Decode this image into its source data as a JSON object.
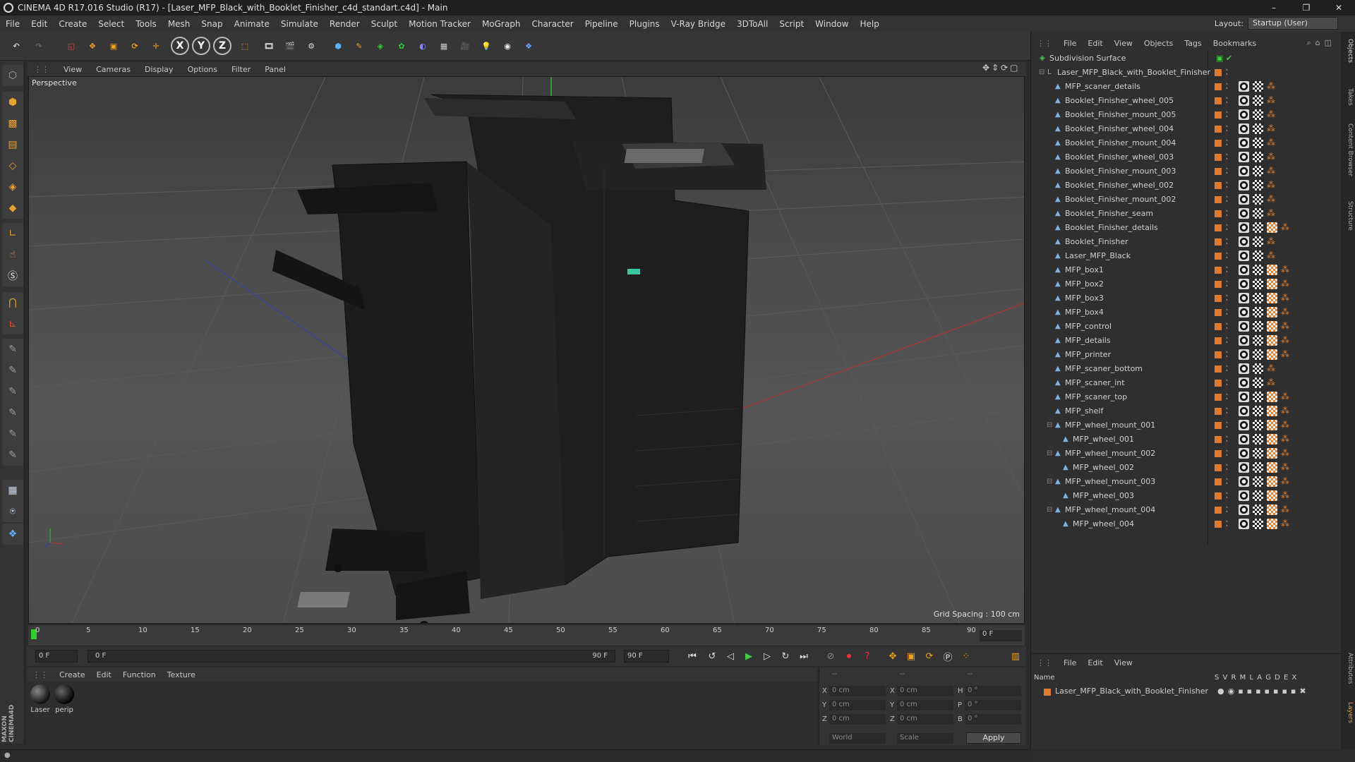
{
  "titlebar": {
    "title": "CINEMA 4D R17.016 Studio (R17) - [Laser_MFP_Black_with_Booklet_Finisher_c4d_standart.c4d] - Main",
    "minimize": "–",
    "maximize": "❐",
    "close": "✕"
  },
  "menu": [
    "File",
    "Edit",
    "Create",
    "Select",
    "Tools",
    "Mesh",
    "Snap",
    "Animate",
    "Simulate",
    "Render",
    "Sculpt",
    "Motion Tracker",
    "MoGraph",
    "Character",
    "Pipeline",
    "Plugins",
    "V-Ray Bridge",
    "3DToAll",
    "Script",
    "Window",
    "Help"
  ],
  "layout": {
    "label": "Layout:",
    "value": "Startup (User)"
  },
  "toolbar": {
    "axis_x": "X",
    "axis_y": "Y",
    "axis_z": "Z"
  },
  "viewport": {
    "menu": [
      "View",
      "Cameras",
      "Display",
      "Options",
      "Filter",
      "Panel"
    ],
    "label": "Perspective",
    "grid_spacing": "Grid Spacing : 100 cm"
  },
  "timeline": {
    "ticks": [
      "0",
      "5",
      "10",
      "15",
      "20",
      "25",
      "30",
      "35",
      "40",
      "45",
      "50",
      "55",
      "60",
      "65",
      "70",
      "75",
      "80",
      "85",
      "90"
    ],
    "end_field": "0 F"
  },
  "transport": {
    "start": "0 F",
    "range_start": "0 F",
    "range_end": "90 F",
    "end": "90 F"
  },
  "materials": {
    "menu": [
      "Create",
      "Edit",
      "Function",
      "Texture"
    ],
    "items": [
      {
        "label": "Laser"
      },
      {
        "label": "perip"
      }
    ]
  },
  "coords": {
    "header_left": "--",
    "header_mid": "--",
    "header_right": "--",
    "rows": [
      {
        "a": "X",
        "av": "0 cm",
        "b": "X",
        "bv": "0 cm",
        "c": "H",
        "cv": "0 °"
      },
      {
        "a": "Y",
        "av": "0 cm",
        "b": "Y",
        "bv": "0 cm",
        "c": "P",
        "cv": "0 °"
      },
      {
        "a": "Z",
        "av": "0 cm",
        "b": "Z",
        "bv": "0 cm",
        "c": "B",
        "cv": "0 °"
      }
    ],
    "mode1": "World",
    "mode2": "Scale",
    "apply": "Apply"
  },
  "object_manager": {
    "menu": [
      "File",
      "Edit",
      "View",
      "Objects",
      "Tags",
      "Bookmarks"
    ],
    "objects": [
      {
        "name": "Subdivision Surface",
        "indent": 0,
        "tags": "none"
      },
      {
        "name": "Laser_MFP_Black_with_Booklet_Finisher",
        "indent": 1,
        "tags": "none"
      },
      {
        "name": "MFP_scaner_details",
        "indent": 2,
        "tags": "abd"
      },
      {
        "name": "Booklet_Finisher_wheel_005",
        "indent": 2,
        "tags": "abd"
      },
      {
        "name": "Booklet_Finisher_mount_005",
        "indent": 2,
        "tags": "abd"
      },
      {
        "name": "Booklet_Finisher_wheel_004",
        "indent": 2,
        "tags": "abd"
      },
      {
        "name": "Booklet_Finisher_mount_004",
        "indent": 2,
        "tags": "abd"
      },
      {
        "name": "Booklet_Finisher_wheel_003",
        "indent": 2,
        "tags": "abd"
      },
      {
        "name": "Booklet_Finisher_mount_003",
        "indent": 2,
        "tags": "abd"
      },
      {
        "name": "Booklet_Finisher_wheel_002",
        "indent": 2,
        "tags": "abd"
      },
      {
        "name": "Booklet_Finisher_mount_002",
        "indent": 2,
        "tags": "abd"
      },
      {
        "name": "Booklet_Finisher_seam",
        "indent": 2,
        "tags": "abd"
      },
      {
        "name": "Booklet_Finisher_details",
        "indent": 2,
        "tags": "abcd"
      },
      {
        "name": "Booklet_Finisher",
        "indent": 2,
        "tags": "abd"
      },
      {
        "name": "Laser_MFP_Black",
        "indent": 2,
        "tags": "abd"
      },
      {
        "name": "MFP_box1",
        "indent": 2,
        "tags": "abcd"
      },
      {
        "name": "MFP_box2",
        "indent": 2,
        "tags": "abcd"
      },
      {
        "name": "MFP_box3",
        "indent": 2,
        "tags": "abcd"
      },
      {
        "name": "MFP_box4",
        "indent": 2,
        "tags": "abcd"
      },
      {
        "name": "MFP_control",
        "indent": 2,
        "tags": "abcd"
      },
      {
        "name": "MFP_details",
        "indent": 2,
        "tags": "abcd"
      },
      {
        "name": "MFP_printer",
        "indent": 2,
        "tags": "abcd"
      },
      {
        "name": "MFP_scaner_bottom",
        "indent": 2,
        "tags": "abd"
      },
      {
        "name": "MFP_scaner_int",
        "indent": 2,
        "tags": "abd"
      },
      {
        "name": "MFP_scaner_top",
        "indent": 2,
        "tags": "abcd"
      },
      {
        "name": "MFP_shelf",
        "indent": 2,
        "tags": "abcd"
      },
      {
        "name": "MFP_wheel_mount_001",
        "indent": 2,
        "tags": "abcd"
      },
      {
        "name": "MFP_wheel_001",
        "indent": 3,
        "tags": "abcd"
      },
      {
        "name": "MFP_wheel_mount_002",
        "indent": 2,
        "tags": "abcd"
      },
      {
        "name": "MFP_wheel_002",
        "indent": 3,
        "tags": "abcd"
      },
      {
        "name": "MFP_wheel_mount_003",
        "indent": 2,
        "tags": "abcd"
      },
      {
        "name": "MFP_wheel_003",
        "indent": 3,
        "tags": "abcd"
      },
      {
        "name": "MFP_wheel_mount_004",
        "indent": 2,
        "tags": "abcd"
      },
      {
        "name": "MFP_wheel_004",
        "indent": 3,
        "tags": "abcd"
      }
    ]
  },
  "layer_manager": {
    "menu": [
      "File",
      "Edit",
      "View"
    ],
    "header": {
      "name": "Name",
      "cols": "S  V  R  M  L  A  G  D  E  X"
    },
    "layer": "Laser_MFP_Black_with_Booklet_Finisher"
  },
  "sidetabs": [
    "Objects",
    "Takes",
    "Content Browser",
    "Structure",
    "Attributes",
    "Layers"
  ],
  "colors": {
    "accent_orange": "#e07a2f",
    "object_icon_blue": "#7fb2e8",
    "axis_x_red": "#c03030",
    "axis_z_blue": "#3040b0"
  }
}
